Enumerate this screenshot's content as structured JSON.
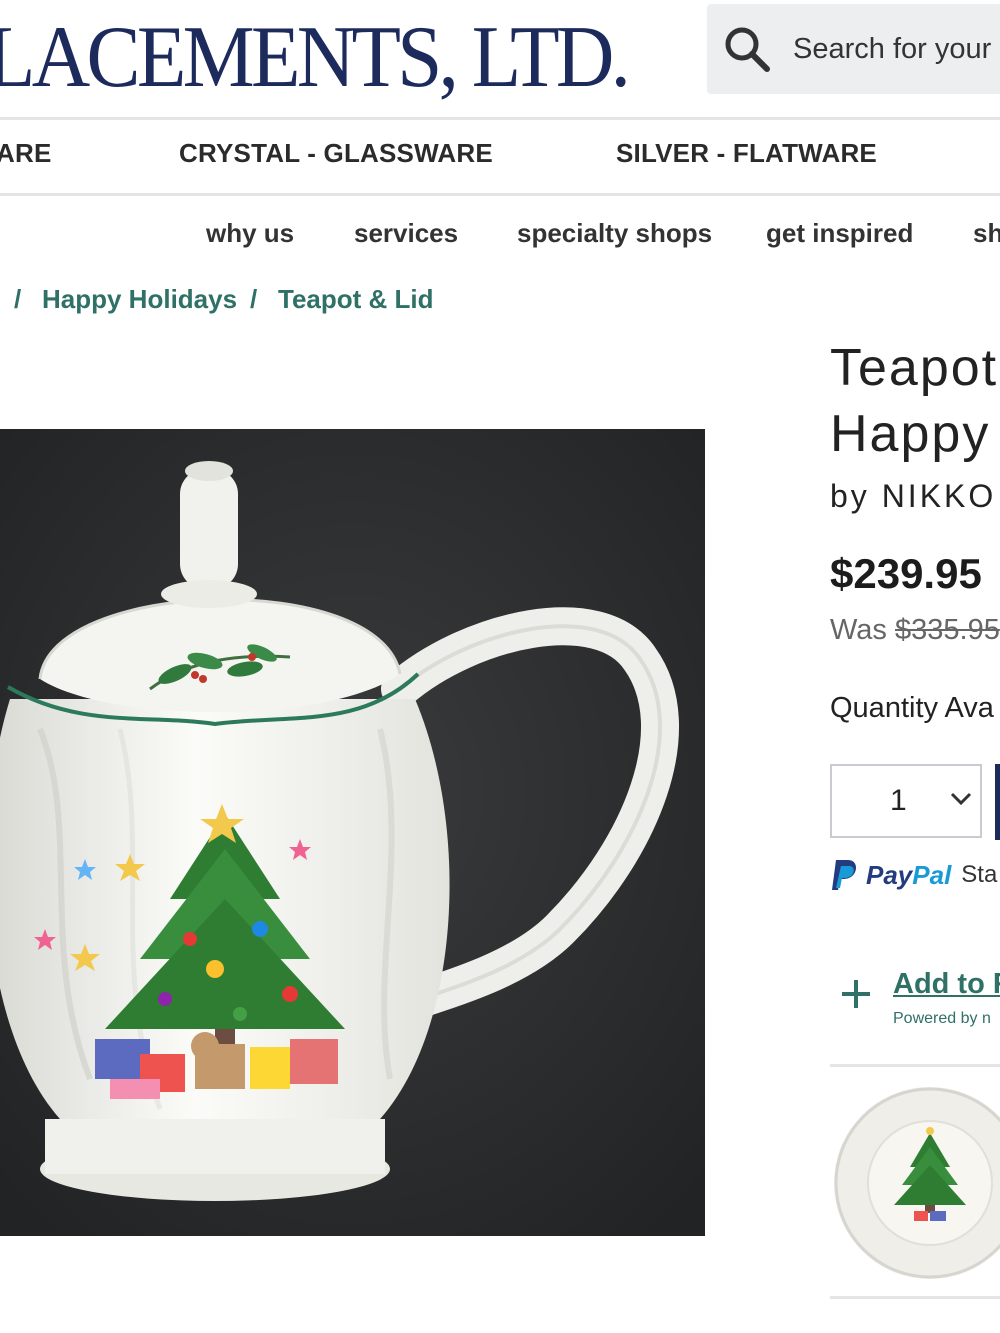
{
  "header": {
    "logo_text": "LACEMENTS, LTD.",
    "search_placeholder": "Search for your"
  },
  "category_nav": [
    "ARE",
    "CRYSTAL - GLASSWARE",
    "SILVER - FLATWARE"
  ],
  "secondary_nav": [
    "why us",
    "services",
    "specialty shops",
    "get inspired",
    "sh"
  ],
  "breadcrumb": {
    "separator": "/",
    "items": [
      "Happy Holidays",
      "Teapot & Lid"
    ]
  },
  "product": {
    "title_line1": "Teapot",
    "title_line2": "Happy",
    "brand": "by NIKKO",
    "price": "$239.95",
    "was_label": "Was",
    "was_price": "$335.95",
    "quantity_label": "Quantity Ava",
    "quantity_value": "1",
    "paypal_pay": "Pay",
    "paypal_pal": "Pal",
    "paypal_extra": "Sta",
    "registry_link": "Add to R",
    "registry_powered": "Powered by n"
  },
  "colors": {
    "brand_navy": "#1d2a5c",
    "link_green": "#2f7067",
    "paypal_blue": "#253b80",
    "paypal_light": "#179bd7"
  },
  "icons": [
    "search-icon",
    "chevron-down-icon",
    "paypal-icon",
    "plus-icon"
  ]
}
